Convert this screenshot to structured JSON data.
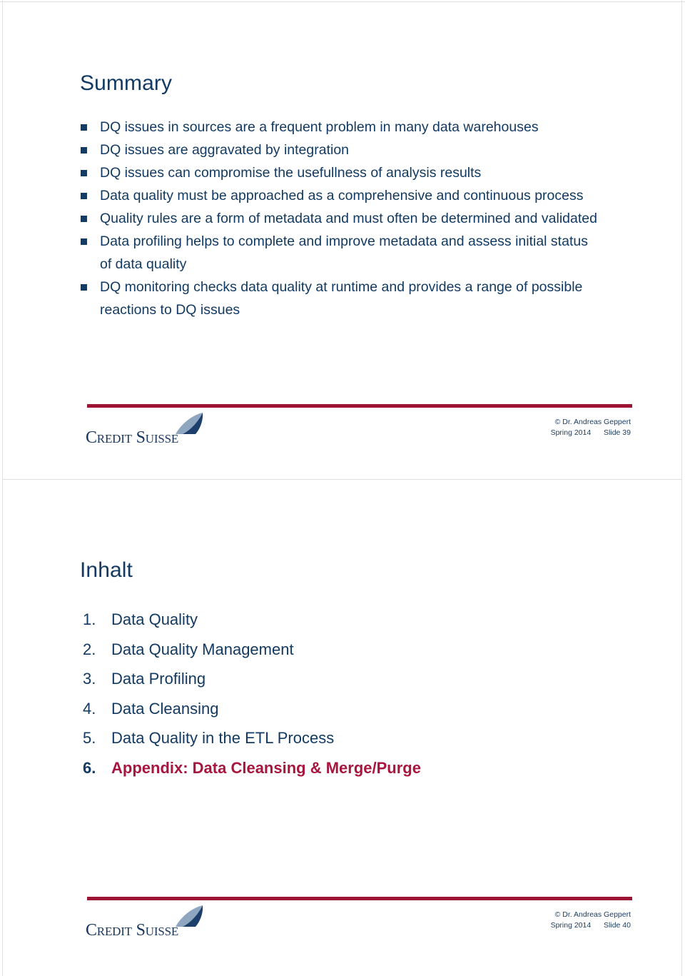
{
  "document": {
    "page_background": "#ffffff",
    "accent_navy": "#133a63",
    "accent_crimson": "#a81640",
    "rule_crimson": "#9c1334"
  },
  "slides": [
    {
      "title": "Summary",
      "bullets": [
        "DQ issues in sources are a frequent problem in many data warehouses",
        "DQ issues are aggravated by integration",
        "DQ issues can compromise the usefullness of analysis results",
        "Data quality must be approached as a comprehensive and continuous process",
        "Quality rules are a form of metadata and must often be determined and validated",
        "Data profiling helps to complete and improve metadata and assess initial status of data quality",
        "DQ monitoring checks data quality at runtime and provides a range of possible reactions to DQ issues"
      ],
      "footer": {
        "logo_text": "Credit Suisse",
        "logo_icon": "sail-swoosh-icon",
        "copyright": "© Dr. Andreas Geppert",
        "term": "Spring 2014",
        "slide_number": "Slide 39"
      }
    },
    {
      "title": "Inhalt",
      "items": [
        {
          "index": "1.",
          "text": "Data Quality",
          "accent": false
        },
        {
          "index": "2.",
          "text": "Data Quality Management",
          "accent": false
        },
        {
          "index": "3.",
          "text": "Data Profiling",
          "accent": false
        },
        {
          "index": "4.",
          "text": "Data Cleansing",
          "accent": false
        },
        {
          "index": "5.",
          "text": "Data Quality in the ETL Process",
          "accent": false
        },
        {
          "index": "6.",
          "text": "Appendix: Data Cleansing & Merge/Purge",
          "accent": true
        }
      ],
      "footer": {
        "logo_text": "Credit Suisse",
        "logo_icon": "sail-swoosh-icon",
        "copyright": "© Dr. Andreas Geppert",
        "term": "Spring 2014",
        "slide_number": "Slide 40"
      }
    }
  ]
}
